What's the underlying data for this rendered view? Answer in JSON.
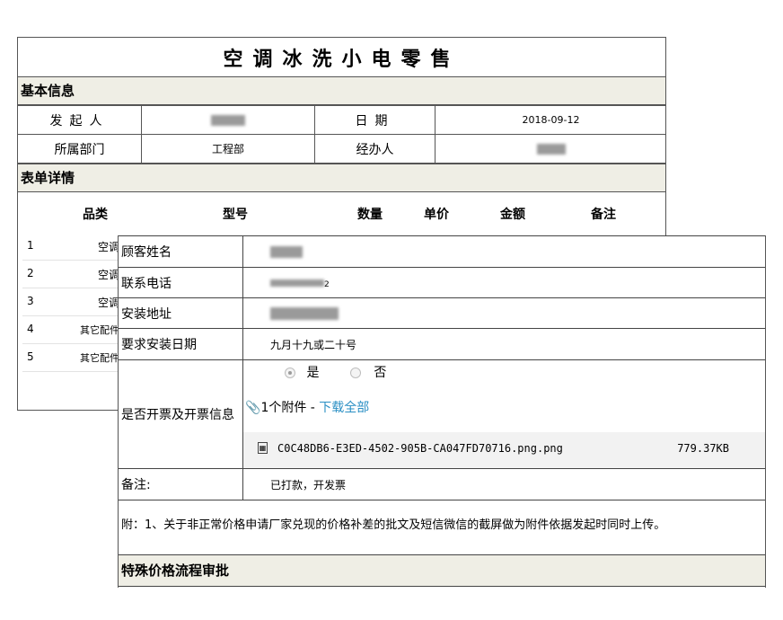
{
  "form": {
    "title": "空调冰洗小电零售"
  },
  "basic": {
    "section": "基本信息",
    "initiator_label": "发起人",
    "date_label": "日期",
    "date_value": "2018-09-12",
    "dept_label": "所属部门",
    "dept_value": "工程部",
    "handler_label": "经办人"
  },
  "detail": {
    "section": "表单详情",
    "headers": [
      "品类",
      "型号",
      "数量",
      "单价",
      "金额",
      "备注"
    ],
    "rows": [
      {
        "num": "1",
        "cat": "空调"
      },
      {
        "num": "2",
        "cat": "空调"
      },
      {
        "num": "3",
        "cat": "空调"
      },
      {
        "num": "4",
        "cat": "其它配件"
      },
      {
        "num": "5",
        "cat": "其它配件"
      }
    ]
  },
  "customer": {
    "name_label": "顾客姓名",
    "phone_label": "联系电话",
    "phone_visible_tail": "2",
    "address_label": "安装地址",
    "install_date_label": "要求安装日期",
    "install_date_value": "九月十九或二十号",
    "invoice_label": "是否开票及开票信息",
    "radio_yes": "是",
    "radio_no": "否",
    "attach_count": "1个附件 - ",
    "download_all": "下载全部",
    "file_name": "C0C48DB6-E3ED-4502-905B-CA047FD70716.png.png",
    "file_size": "779.37KB",
    "remark_label": "备注:",
    "remark_value": "已打款，开发票"
  },
  "footer": {
    "note": "附：1、关于非正常价格申请厂家兑现的价格补差的批文及短信微信的截屏做为附件依据发起时同时上传。",
    "special_section": "特殊价格流程审批"
  },
  "icons": {
    "attach": "paperclip-icon",
    "file": "image-file-icon"
  },
  "colors": {
    "section_bg": "#efeee5",
    "link": "#2a8fc4"
  }
}
